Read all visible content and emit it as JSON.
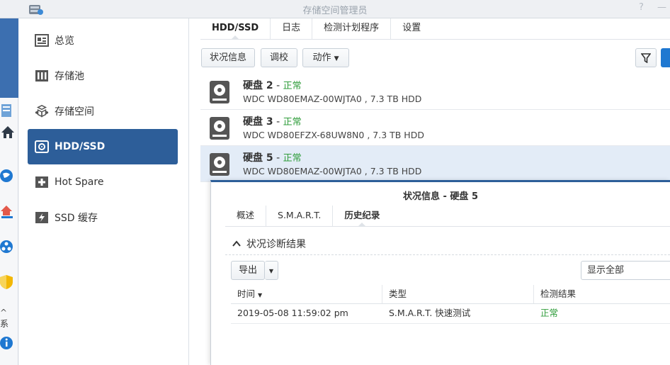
{
  "window": {
    "title": "存储空间管理员"
  },
  "sidebar": {
    "items": [
      {
        "label": "总览",
        "icon": "overview-icon"
      },
      {
        "label": "存储池",
        "icon": "storage-pool-icon"
      },
      {
        "label": "存储空间",
        "icon": "volume-icon"
      },
      {
        "label": "HDD/SSD",
        "icon": "hdd-icon"
      },
      {
        "label": "Hot Spare",
        "icon": "hot-spare-icon"
      },
      {
        "label": "SSD 缓存",
        "icon": "ssd-cache-icon"
      }
    ],
    "active_index": 3
  },
  "desktop": {
    "partial_label": "系"
  },
  "tabs": [
    "HDD/SSD",
    "日志",
    "检测计划程序",
    "设置"
  ],
  "toolbar": {
    "status_info": "状况信息",
    "calibrate": "调校",
    "action": "动作"
  },
  "disks": [
    {
      "name": "硬盘 2",
      "sep": " - ",
      "status": "正常",
      "detail": "WDC WD80EMAZ-00WJTA0 , 7.3 TB HDD"
    },
    {
      "name": "硬盘 3",
      "sep": " - ",
      "status": "正常",
      "detail": "WDC WD80EFZX-68UW8N0 , 7.3 TB HDD"
    },
    {
      "name": "硬盘 5",
      "sep": " - ",
      "status": "正常",
      "detail": "WDC WD80EMAZ-00WJTA0 , 7.3 TB HDD"
    }
  ],
  "dialog": {
    "title": "状况信息 - 硬盘 5",
    "tabs": [
      "概述",
      "S.M.A.R.T.",
      "历史纪录"
    ],
    "section": "状况诊断结果",
    "export": "导出",
    "filter": "显示全部",
    "columns": {
      "time": "时间",
      "type": "类型",
      "result": "检测结果"
    },
    "rows": [
      {
        "time": "2019-05-08 11:59:02 pm",
        "type": "S.M.A.R.T. 快速测试",
        "result": "正常"
      }
    ]
  },
  "colors": {
    "accent": "#2d5e99",
    "ok": "#2e9c3a"
  }
}
